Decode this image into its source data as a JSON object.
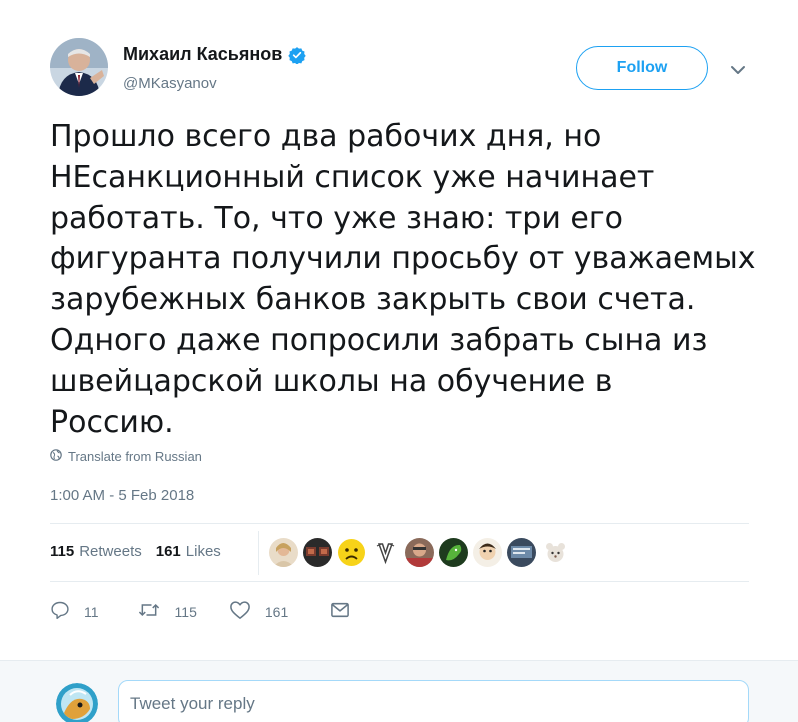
{
  "author": {
    "name": "Михаил Касьянов",
    "handle": "@MKasyanov",
    "verified": true
  },
  "follow_label": "Follow",
  "tweet_text": "Прошло всего два рабочих дня, но\nНЕсанкционный список уже начинает\nработать. То, что уже знаю: три его\nфигуранта получили просьбу от уважаемых\nзарубежных банков закрыть свои счета.\nОдного даже попросили забрать сына из\nшвейцарской школы на обучение в\nРоссию.",
  "translate_label": "Translate from Russian",
  "timestamp": "1:00 AM - 5 Feb 2018",
  "stats": {
    "retweets_count": "115",
    "retweets_label": "Retweets",
    "likes_count": "161",
    "likes_label": "Likes"
  },
  "likers": [
    "liker-1",
    "liker-2",
    "liker-3",
    "liker-4",
    "liker-5",
    "liker-6",
    "liker-7",
    "liker-8",
    "liker-9"
  ],
  "actions": {
    "reply_count": "11",
    "retweet_count": "115",
    "like_count": "161"
  },
  "reply": {
    "placeholder": "Tweet your reply"
  },
  "colors": {
    "accent": "#1da1f2",
    "text": "#14171a",
    "muted": "#657786",
    "border": "#e6ecf0"
  },
  "icons": [
    "verified-badge-icon",
    "chevron-down-icon",
    "globe-icon",
    "reply-icon",
    "retweet-icon",
    "heart-icon",
    "envelope-icon"
  ]
}
